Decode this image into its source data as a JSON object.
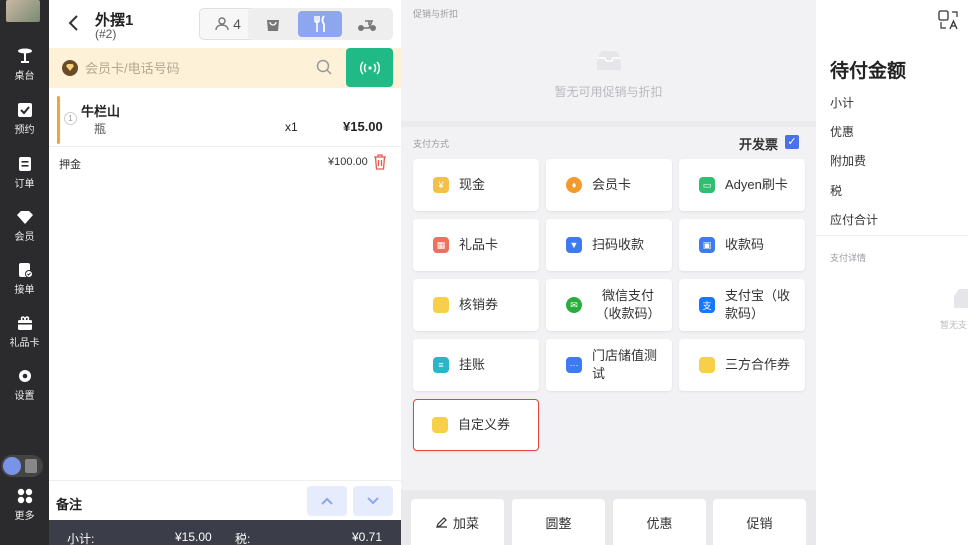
{
  "nav": {
    "items": [
      {
        "label": "桌台",
        "icon": "table-icon"
      },
      {
        "label": "预约",
        "icon": "reservation-icon"
      },
      {
        "label": "订单",
        "icon": "order-icon"
      },
      {
        "label": "会员",
        "icon": "member-icon"
      },
      {
        "label": "接单",
        "icon": "accept-order-icon"
      },
      {
        "label": "礼品卡",
        "icon": "gift-card-icon"
      },
      {
        "label": "设置",
        "icon": "settings-icon"
      },
      {
        "label": "更多",
        "icon": "more-icon"
      }
    ]
  },
  "order": {
    "title": "外摆1",
    "subtitle": "(#2)",
    "people": "4",
    "member_placeholder": "会员卡/电话号码",
    "items": [
      {
        "index": "1",
        "name": "牛栏山",
        "unit": "瓶",
        "qty": "x1",
        "price": "¥15.00"
      }
    ],
    "deposit_label": "押金",
    "deposit_amount": "¥100.00",
    "notes_label": "备注",
    "summary": {
      "subtotal_label": "小计:",
      "subtotal": "¥15.00",
      "tax_label": "税:",
      "tax": "¥0.71"
    }
  },
  "promo": {
    "section_label": "促销与折扣",
    "empty_text": "暂无可用促销与折扣"
  },
  "payment": {
    "section_label": "支付方式",
    "invoice_label": "开发票",
    "methods": [
      {
        "label": "现金",
        "icon": "cash-icon",
        "color": "#f3c04a"
      },
      {
        "label": "会员卡",
        "icon": "member-card-icon",
        "color": "#f39a2a"
      },
      {
        "label": "Adyen刷卡",
        "icon": "card-swipe-icon",
        "color": "#2fbf71"
      },
      {
        "label": "礼品卡",
        "icon": "gift-icon",
        "color": "#f07060"
      },
      {
        "label": "扫码收款",
        "icon": "scan-icon",
        "color": "#3e7bf0"
      },
      {
        "label": "收款码",
        "icon": "qr-code-icon",
        "color": "#3e7bf0"
      },
      {
        "label": "核销券",
        "icon": "voucher-icon",
        "color": "#f8cf48"
      },
      {
        "label": "微信支付（收款码）",
        "icon": "wechat-icon",
        "color": "#2aae3b"
      },
      {
        "label": "支付宝（收款码）",
        "icon": "alipay-icon",
        "color": "#1677ff"
      },
      {
        "label": "挂账",
        "icon": "credit-account-icon",
        "color": "#28b6c8"
      },
      {
        "label": "门店储值测试",
        "icon": "store-value-icon",
        "color": "#3e7bf0"
      },
      {
        "label": "三方合作券",
        "icon": "partner-voucher-icon",
        "color": "#f8cf48"
      },
      {
        "label": "自定义券",
        "icon": "custom-voucher-icon",
        "color": "#f8cf48"
      }
    ]
  },
  "bottom_actions": [
    "加菜",
    "圆整",
    "优惠",
    "促销"
  ],
  "summary_panel": {
    "title": "待付金额",
    "rows": [
      "小计",
      "优惠",
      "附加费",
      "税",
      "应付合计"
    ],
    "detail_label": "支付详情",
    "empty_text": "暂无支付"
  },
  "colors": {
    "accent": "#4a72e8",
    "nfc": "#1fba86",
    "selected_border": "#e0463c"
  }
}
